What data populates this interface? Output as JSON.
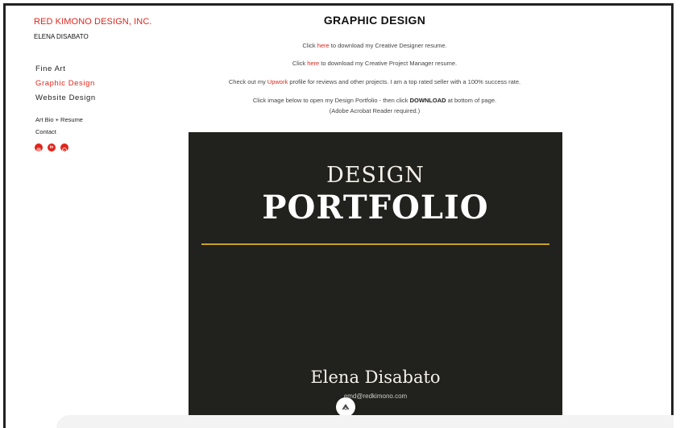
{
  "sidebar": {
    "brand": "RED KIMONO DESIGN, INC.",
    "owner": "ELENA DISABATO",
    "nav": [
      "Fine Art",
      "Graphic Design",
      "Website Design"
    ],
    "nav_secondary": [
      "Art Bio + Resume",
      "Contact"
    ],
    "socials": [
      "instagram-icon",
      "linkedin-icon",
      "pinterest-icon"
    ],
    "accent_color": "#e0261b"
  },
  "main": {
    "title": "GRAPHIC DESIGN",
    "line1": {
      "pre": "Click ",
      "link": "here",
      "post": " to download my Creative Designer resume."
    },
    "line2": {
      "pre": "Click ",
      "link": "here",
      "post": " to download my Creative Project Manager resume."
    },
    "line3": {
      "pre": "Check out my ",
      "link": "Upwork",
      "post": " profile for reviews and other projects. I am a top rated seller with a 100% success rate."
    },
    "line4": {
      "pre": "Click image below to open my Design Portfolio - then click ",
      "bold": "DOWNLOAD",
      "post": " at bottom of page."
    },
    "line5": "(Adobe Acrobat Reader required.)"
  },
  "cover": {
    "line1": "DESIGN",
    "line2": "PORTFOLIO",
    "name": "Elena Disabato",
    "email": "emd@redkimono.com",
    "background": "#21211d",
    "rule_color": "#c9a227"
  }
}
